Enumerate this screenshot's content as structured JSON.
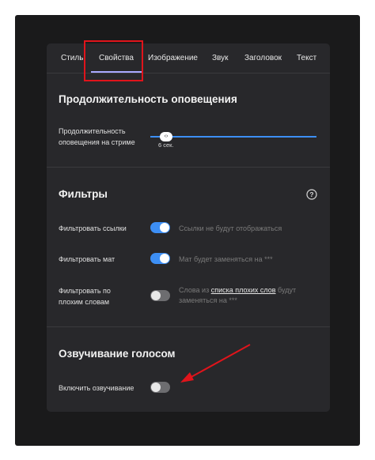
{
  "tabs": [
    {
      "label": "Стиль"
    },
    {
      "label": "Свойства"
    },
    {
      "label": "Изображение"
    },
    {
      "label": "Звук"
    },
    {
      "label": "Заголовок"
    },
    {
      "label": "Текст"
    }
  ],
  "active_tab": "Свойства",
  "notification_duration": {
    "title": "Продолжительность оповещения",
    "slider_label": "Продолжительность оповещения на стриме",
    "slider_value": "6 сек.",
    "thumb_glyph": "‹›"
  },
  "filters": {
    "title": "Фильтры",
    "rows": [
      {
        "label": "Фильтровать ссылки",
        "enabled": true,
        "desc": "Ссылки не будут отображаться"
      },
      {
        "label": "Фильтровать мат",
        "enabled": true,
        "desc": "Мат будет заменяться на ***"
      },
      {
        "label": "Фильтровать по плохим словам",
        "enabled": false,
        "desc_before": "Слова из ",
        "desc_link": "списка плохих слов",
        "desc_after": " будут заменяться на ***"
      }
    ]
  },
  "voice": {
    "title": "Озвучивание голосом",
    "toggle_label": "Включить озвучивание",
    "enabled": false
  },
  "colors": {
    "accent": "#3d8ff5",
    "highlight": "#e0141b",
    "panel": "#28282b"
  }
}
